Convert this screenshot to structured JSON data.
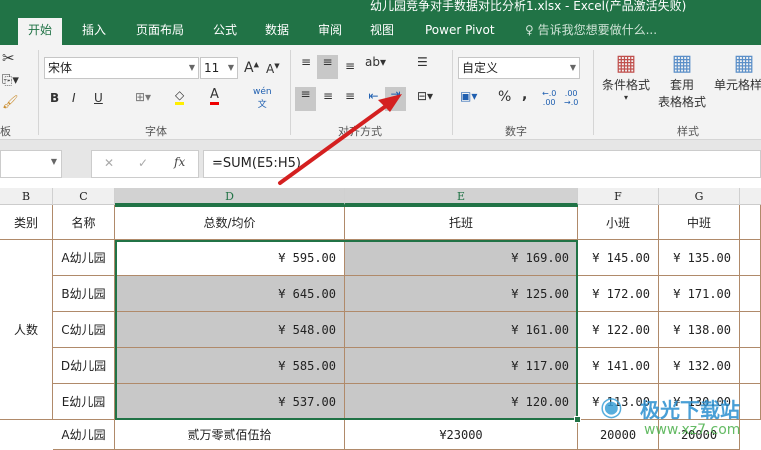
{
  "title": "幼儿园竞争对手数据对比分析1.xlsx - Excel(产品激活失败)",
  "tabs": [
    "开始",
    "插入",
    "页面布局",
    "公式",
    "数据",
    "审阅",
    "视图",
    "Power Pivot"
  ],
  "tell_me": "告诉我您想要做什么...",
  "ribbon": {
    "font_name": "宋体",
    "font_size": "11",
    "number_format": "自定义",
    "groups": {
      "clipboard": "板",
      "font": "字体",
      "alignment": "对齐方式",
      "number": "数字",
      "styles": "样式"
    },
    "bold": "B",
    "italic": "I",
    "underline": "U",
    "percent": "%",
    "comma": ",",
    "cond_format": "条件格式",
    "table_format_1": "套用",
    "table_format_2": "表格格式",
    "cell_styles": "单元格样式"
  },
  "formula_bar": {
    "fx": "fx",
    "formula": "=SUM(E5:H5)"
  },
  "columns": [
    "B",
    "C",
    "D",
    "E",
    "F",
    "G"
  ],
  "headers": {
    "category": "类别",
    "name": "名称",
    "total": "总数/均价",
    "tuoban": "托班",
    "xiaoban": "小班",
    "zhongban": "中班"
  },
  "category_label": "人数",
  "rows": [
    {
      "name": "A幼儿园",
      "total": "¥ 595.00",
      "tuoban": "¥ 169.00",
      "xiaoban": "¥  145.00",
      "zhongban": "¥  135.00"
    },
    {
      "name": "B幼儿园",
      "total": "¥ 645.00",
      "tuoban": "¥ 125.00",
      "xiaoban": "¥  172.00",
      "zhongban": "¥  171.00"
    },
    {
      "name": "C幼儿园",
      "total": "¥ 548.00",
      "tuoban": "¥ 161.00",
      "xiaoban": "¥  122.00",
      "zhongban": "¥  138.00"
    },
    {
      "name": "D幼儿园",
      "total": "¥ 585.00",
      "tuoban": "¥ 117.00",
      "xiaoban": "¥  141.00",
      "zhongban": "¥  132.00"
    },
    {
      "name": "E幼儿园",
      "total": "¥ 537.00",
      "tuoban": "¥ 120.00",
      "xiaoban": "¥  113.00",
      "zhongban": "¥  130.00"
    }
  ],
  "last_row": {
    "name": "A幼儿园",
    "total": "贰万零贰佰伍拾",
    "tuoban": "¥23000",
    "xiaoban": "20000",
    "zhongban": "20000"
  },
  "watermark": {
    "name": "极光下载站",
    "url": "www.xz7.com"
  }
}
